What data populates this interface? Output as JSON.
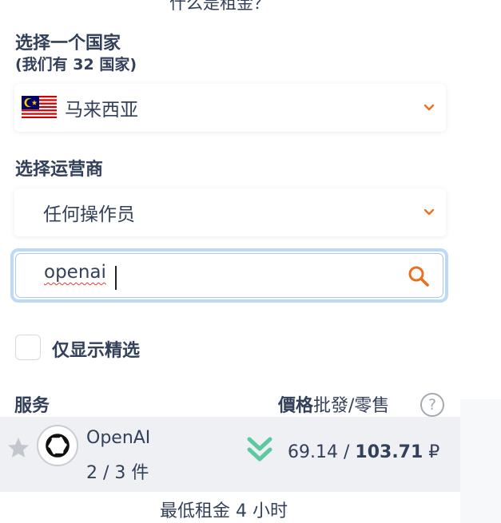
{
  "header": {
    "top_link": "什么是租金？"
  },
  "country": {
    "title": "选择一个国家",
    "subtitle": "(我们有 32 国家)",
    "selected": "马来西亚",
    "flag_icon": "malaysia-flag-icon"
  },
  "operator": {
    "title": "选择运营商",
    "selected": "任何操作员"
  },
  "search": {
    "value": "openai",
    "icon": "search-icon"
  },
  "filter": {
    "featured_only_label": "仅显示精选",
    "checked": false
  },
  "table": {
    "col_service": "服务",
    "col_price_bold": "價格",
    "col_price_rest": "批發/零售",
    "help": "?",
    "rows": [
      {
        "name": "OpenAI",
        "count": "2 / 3 件",
        "price_wholesale": "69.14 /",
        "price_retail": "103.71",
        "currency": "₽"
      }
    ]
  },
  "footer": {
    "note": "最低租金 4 小时"
  },
  "colors": {
    "accent_orange": "#e8711f",
    "text_dark": "#33405a",
    "green_arrows": "#5cc9a0",
    "search_focus": "#bcd9f7"
  }
}
